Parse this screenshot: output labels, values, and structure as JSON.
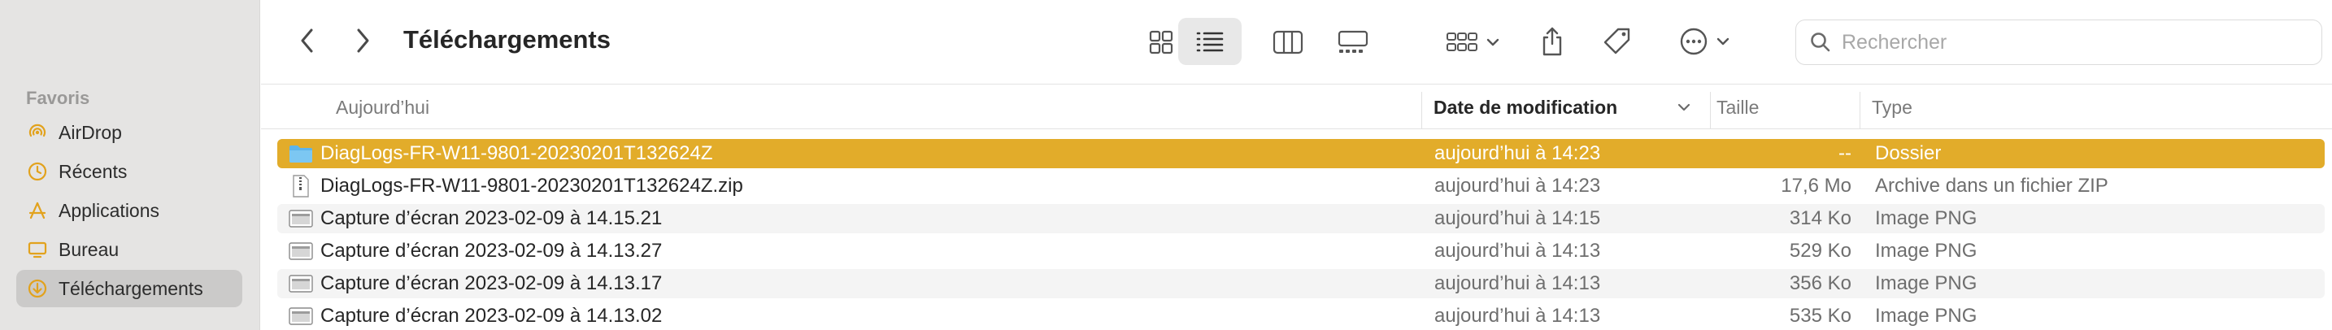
{
  "sidebar": {
    "section_title": "Favoris",
    "items": [
      {
        "label": "AirDrop",
        "icon": "airdrop-icon"
      },
      {
        "label": "Récents",
        "icon": "clock-icon"
      },
      {
        "label": "Applications",
        "icon": "applications-icon"
      },
      {
        "label": "Bureau",
        "icon": "desktop-icon"
      },
      {
        "label": "Téléchargements",
        "icon": "downloads-icon",
        "active": true
      }
    ],
    "accent_color": "#e2ac2a"
  },
  "toolbar": {
    "title": "Téléchargements",
    "search_placeholder": "Rechercher",
    "view_mode": "list"
  },
  "columns": {
    "name": "Aujourd’hui",
    "date": "Date de modification",
    "size": "Taille",
    "type": "Type"
  },
  "rows": [
    {
      "name": "DiagLogs-FR-W11-9801-20230201T132624Z",
      "date": "aujourd’hui à 14:23",
      "size": "--",
      "type": "Dossier",
      "icon": "folder-icon",
      "selected": true
    },
    {
      "name": "DiagLogs-FR-W11-9801-20230201T132624Z.zip",
      "date": "aujourd’hui à 14:23",
      "size": "17,6 Mo",
      "type": "Archive dans un fichier ZIP",
      "icon": "zip-file-icon"
    },
    {
      "name": "Capture d’écran 2023-02-09 à 14.15.21",
      "date": "aujourd’hui à 14:15",
      "size": "314 Ko",
      "type": "Image PNG",
      "icon": "image-file-icon"
    },
    {
      "name": "Capture d’écran 2023-02-09 à 14.13.27",
      "date": "aujourd’hui à 14:13",
      "size": "529 Ko",
      "type": "Image PNG",
      "icon": "image-file-icon"
    },
    {
      "name": "Capture d’écran 2023-02-09 à 14.13.17",
      "date": "aujourd’hui à 14:13",
      "size": "356 Ko",
      "type": "Image PNG",
      "icon": "image-file-icon"
    },
    {
      "name": "Capture d’écran 2023-02-09 à 14.13.02",
      "date": "aujourd’hui à 14:13",
      "size": "535 Ko",
      "type": "Image PNG",
      "icon": "image-file-icon"
    }
  ]
}
